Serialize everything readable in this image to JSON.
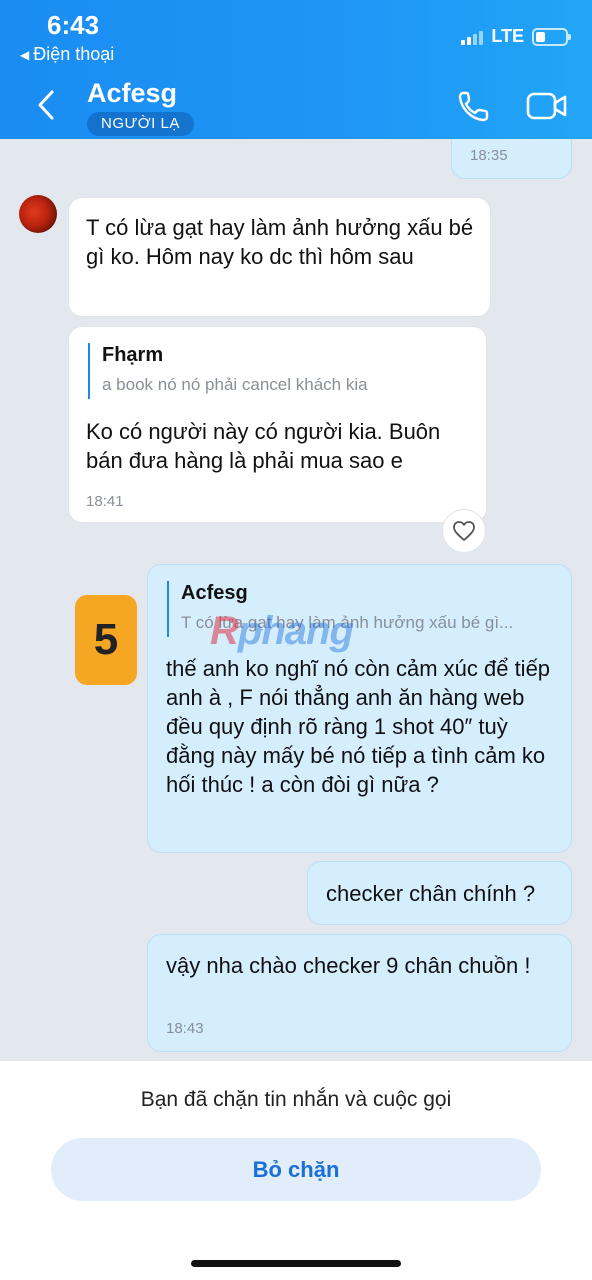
{
  "status_bar": {
    "time": "6:43",
    "back_app_label": "Điện thoại",
    "network": "LTE"
  },
  "header": {
    "contact_name": "Acfesg",
    "badge": "NGƯỜI LẠ",
    "back_icon": "chevron-left-icon",
    "call_icon": "phone-icon",
    "video_icon": "video-camera-icon"
  },
  "messages": [
    {
      "type": "outgoing-partial",
      "time": "18:35"
    },
    {
      "type": "incoming",
      "text": "T có lừa gạt hay làm ảnh hưởng xấu bé gì ko. Hôm nay ko dc thì hôm sau"
    },
    {
      "type": "incoming",
      "quote_name": "Fhạrm",
      "quote_text": "a book nó nó phải cancel khách kia",
      "text": "Ko có người này có người kia. Buôn bán đưa hàng là phải mua sao e",
      "time": "18:41"
    },
    {
      "type": "outgoing",
      "quote_name": "Acfesg",
      "quote_text": "T có lừa gạt hay làm ảnh hưởng xấu bé gì...",
      "text": "thế anh ko nghĩ nó còn cảm xúc để tiếp anh à , F nói thẳng anh ăn hàng web đều quy định rõ ràng 1 shot 40″ tuỳ đằng này mấy bé nó tiếp a tình cảm ko hối thúc ! a còn đòi gì nữa ?"
    },
    {
      "type": "outgoing",
      "text": "checker chân chính ?"
    },
    {
      "type": "outgoing",
      "text": "vậy nha chào checker 9 chân chuồn !",
      "time": "18:43"
    }
  ],
  "overlay": {
    "badge_number": "5",
    "watermark_left": "R",
    "watermark_right": "phang"
  },
  "bottom": {
    "blocked_text": "Bạn đã chặn tin nhắn và cuộc gọi",
    "unblock_label": "Bỏ chặn"
  },
  "colors": {
    "header": "#1e97f5",
    "outgoing_bubble": "#d5eefd",
    "incoming_bubble": "#ffffff",
    "accent": "#1a6fd8",
    "badge": "#f5a623"
  }
}
